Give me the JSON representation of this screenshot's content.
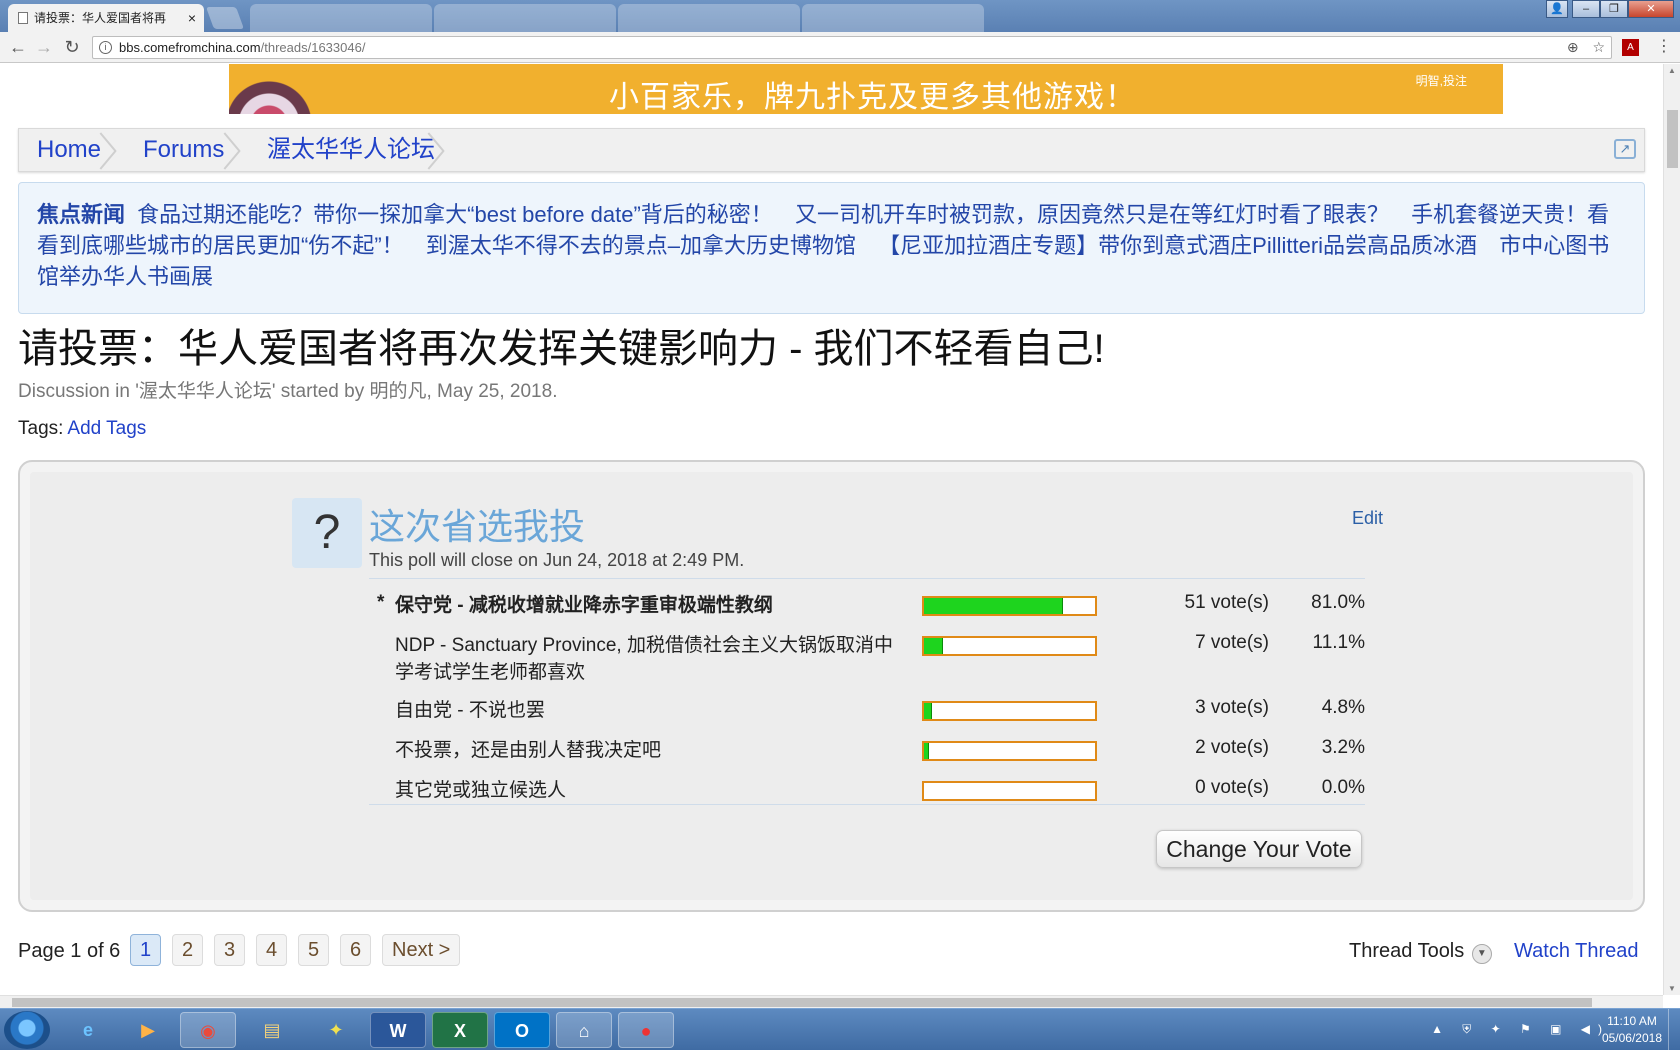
{
  "browser": {
    "active_tab_title": "请投票：华人爱国者将再",
    "tab_close": "×",
    "background_tabs": [
      "",
      "",
      "",
      ""
    ],
    "url_host": "bbs.comefromchina.com",
    "url_path": "/threads/1633046/",
    "info_icon": "i",
    "back_icon": "←",
    "forward_icon": "→",
    "reload_icon": "↻",
    "zoom_icon": "⊕",
    "star_icon": "☆",
    "menu_icon": "⋮",
    "window_user_icon": "👤",
    "window_min": "–",
    "window_max": "❐",
    "window_close": "✕"
  },
  "banner": {
    "text": "小百家乐，牌九扑克及更多其他游戏！",
    "small_text": "明智,投注"
  },
  "breadcrumb": {
    "items": [
      "Home",
      "Forums",
      "渥太华华人论坛"
    ],
    "jump_icon": "↗"
  },
  "news": {
    "label": "焦点新闻",
    "items": [
      "食品过期还能吃？带你一探加拿大“best before date”背后的秘密！",
      "又一司机开车时被罚款，原因竟然只是在等红灯时看了眼表？",
      "手机套餐逆天贵！看看到底哪些城市的居民更加“伤不起”！",
      "到渥太华不得不去的景点–加拿大历史博物馆",
      "【尼亚加拉酒庄专题】带你到意式酒庄Pillitteri品尝高品质冰酒",
      "市中心图书馆举办华人书画展"
    ]
  },
  "thread": {
    "title": "请投票：华人爱国者将再次发挥关键影响力 - 我们不轻看自己!",
    "meta_prefix": "Discussion in '",
    "forum": "渥太华华人论坛",
    "meta_mid": "' started by ",
    "author": "明的凡",
    "meta_date": ", May 25, 2018.",
    "tags_label": "Tags:",
    "add_tags": "Add Tags"
  },
  "poll": {
    "icon": "?",
    "question": "这次省选我投",
    "close_text": "This poll will close on Jun 24, 2018 at 2:49 PM.",
    "edit": "Edit",
    "my_vote_marker": "*",
    "options": [
      {
        "label": "保守党 - 减税收增就业降赤字重审极端性教纲",
        "votes": "51 vote(s)",
        "percent": "81.0%",
        "share": 0.81
      },
      {
        "label": "NDP - Sanctuary Province, 加税借债社会主义大锅饭取消中学考试学生老师都喜欢",
        "votes": "7 vote(s)",
        "percent": "11.1%",
        "share": 0.111
      },
      {
        "label": "自由党 - 不说也罢",
        "votes": "3 vote(s)",
        "percent": "4.8%",
        "share": 0.048
      },
      {
        "label": "不投票，还是由别人替我决定吧",
        "votes": "2 vote(s)",
        "percent": "3.2%",
        "share": 0.032
      },
      {
        "label": "其它党或独立候选人",
        "votes": "0 vote(s)",
        "percent": "0.0%",
        "share": 0.0
      }
    ],
    "change_vote": "Change Your Vote"
  },
  "pagination": {
    "label": "Page 1 of 6",
    "pages": [
      "1",
      "2",
      "3",
      "4",
      "5",
      "6"
    ],
    "current": "1",
    "next": "Next >"
  },
  "thread_tools": {
    "label": "Thread Tools",
    "dropdown_icon": "▼",
    "watch": "Watch Thread"
  },
  "taskbar": {
    "apps": [
      {
        "name": "internet-explorer",
        "glyph": "e"
      },
      {
        "name": "media-player",
        "glyph": "▶"
      },
      {
        "name": "chrome",
        "glyph": "◉"
      },
      {
        "name": "file-explorer",
        "glyph": "▤"
      },
      {
        "name": "sticky-app",
        "glyph": "✦"
      },
      {
        "name": "word",
        "glyph": "W"
      },
      {
        "name": "excel",
        "glyph": "X"
      },
      {
        "name": "outlook",
        "glyph": "O"
      },
      {
        "name": "remote-tool",
        "glyph": "⌂"
      },
      {
        "name": "game-app",
        "glyph": "●"
      }
    ],
    "tray_icons": "▲ ⛨ ✦ ⚑ ▣ ◀)",
    "time": "11:10 AM",
    "date": "05/06/2018"
  }
}
